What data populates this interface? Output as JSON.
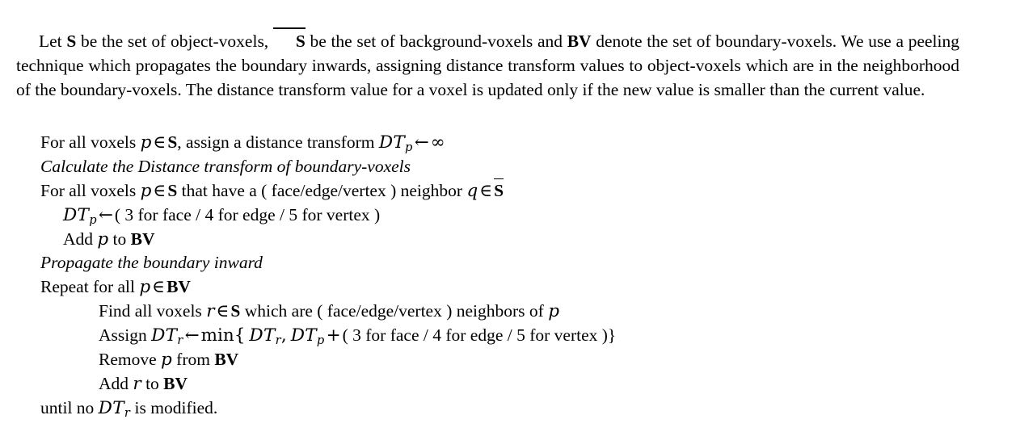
{
  "document": {
    "type": "algorithm-description",
    "background_color": "#ffffff",
    "text_color": "#000000"
  },
  "paragraph": {
    "seg1": "Let ",
    "sym_S": "S",
    "seg2": " be the set of object-voxels, ",
    "sym_Sbar": "S",
    "seg3": " be the set of background-voxels and ",
    "sym_BV": "BV",
    "seg4": " denote the set of boundary-voxels. We use a peeling technique which propagates the boundary inwards, assigning distance transform values to object-voxels which are in the neighborhood of the boundary-voxels. The distance transform value for a voxel is updated only if the new value is smaller than the current value."
  },
  "algorithm": {
    "line1": {
      "a": "For all voxels ",
      "p": "p",
      "b": " ",
      "in": "∈",
      "c": " ",
      "S": "S",
      "d": ", assign a distance transform ",
      "DT": "DT",
      "sub": "p",
      "arrow": "←",
      "inf": "∞"
    },
    "line2": "Calculate the Distance transform of boundary-voxels",
    "line3": {
      "a": "For all voxels ",
      "p": "p",
      "in": "∈",
      "S": "S",
      "b": " that have a ( face/edge/vertex ) neighbor ",
      "q": "q",
      "in2": "∈",
      "Sbar": "S"
    },
    "line4": {
      "DT": "DT",
      "sub": "p",
      "arrow": "←",
      "rest": "( 3 for face / 4 for edge / 5 for vertex )"
    },
    "line5": {
      "a": "Add ",
      "p": "p",
      "b": " to ",
      "BV": "BV"
    },
    "line6": "Propagate the boundary inward",
    "line7": {
      "a": "Repeat for all ",
      "p": "p",
      "in": "∈",
      "BV": "BV"
    },
    "line8": {
      "a": "Find all voxels ",
      "r": "r",
      "in": "∈",
      "S": "S",
      "b": " which are ( face/edge/vertex ) neighbors of ",
      "p": "p"
    },
    "line9": {
      "a": "Assign ",
      "DT1": "DT",
      "sub1": "r",
      "arrow": "←",
      "min": "min{",
      "DT2": "DT",
      "sub2": "r",
      "comma": ",",
      "DT3": "DT",
      "sub3": "p",
      "plus": "+",
      "rest": "( 3 for face / 4 for edge / 5 for vertex )}"
    },
    "line10": {
      "a": "Remove ",
      "p": "p",
      "b": " from ",
      "BV": "BV"
    },
    "line11": {
      "a": "Add ",
      "r": "r",
      "b": " to ",
      "BV": "BV"
    },
    "line12": {
      "a": "until no ",
      "DT": "DT",
      "sub": "r",
      "b": " is modified."
    }
  }
}
